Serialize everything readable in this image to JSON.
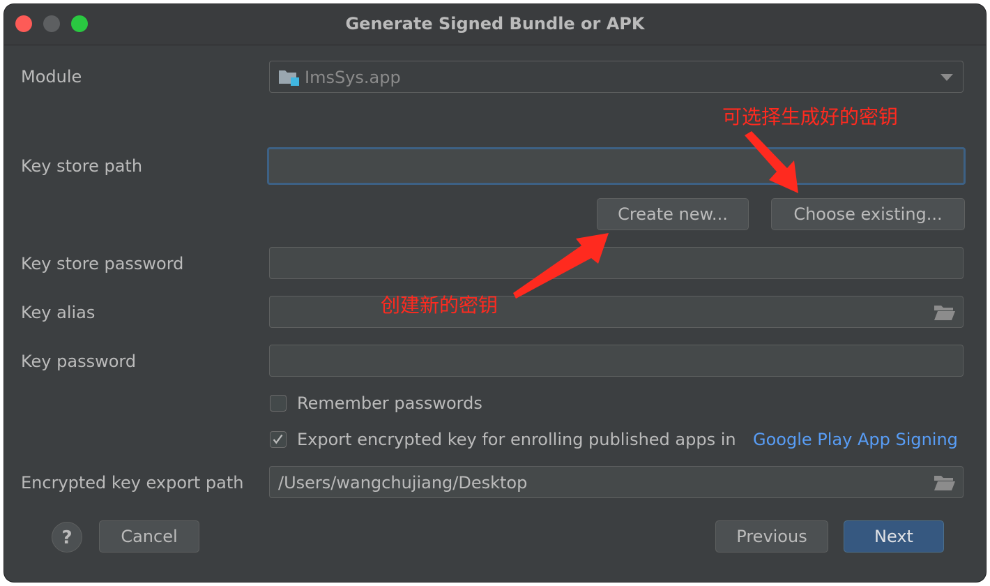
{
  "window": {
    "title": "Generate Signed Bundle or APK"
  },
  "module": {
    "label": "Module",
    "value": "ImsSys.app"
  },
  "keystore": {
    "path_label": "Key store path",
    "path_value": "",
    "create_button": "Create new...",
    "choose_button": "Choose existing...",
    "password_label": "Key store password",
    "password_value": ""
  },
  "key": {
    "alias_label": "Key alias",
    "alias_value": "",
    "password_label": "Key password",
    "password_value": ""
  },
  "options": {
    "remember_label": "Remember passwords",
    "remember_checked": false,
    "export_label": "Export encrypted key for enrolling published apps in",
    "export_checked": true,
    "export_link": "Google Play App Signing"
  },
  "export_path": {
    "label": "Encrypted key export path",
    "value": "/Users/wangchujiang/Desktop"
  },
  "footer": {
    "help": "?",
    "cancel": "Cancel",
    "previous": "Previous",
    "next": "Next"
  },
  "annotations": {
    "choose_note": "可选择生成好的密钥",
    "create_note": "创建新的密钥",
    "color": "#ff2a1f"
  },
  "icons": [
    "folder-icon",
    "chevron-down-icon",
    "checkmark-icon",
    "help-icon"
  ]
}
